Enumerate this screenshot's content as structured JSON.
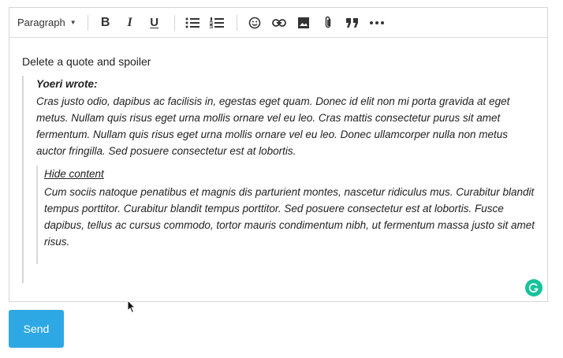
{
  "toolbar": {
    "format_label": "Paragraph",
    "buttons": [
      {
        "name": "bold-button",
        "glyph": "B"
      },
      {
        "name": "italic-button",
        "glyph": "I"
      },
      {
        "name": "underline-button",
        "glyph": "U"
      }
    ]
  },
  "editor": {
    "intro": "Delete a quote and spoiler",
    "quote": {
      "author": "Yoeri wrote:",
      "text": "Cras justo odio, dapibus ac facilisis in, egestas eget quam. Donec id elit non mi porta gravida at eget metus. Nullam quis risus eget urna mollis ornare vel eu leo. Cras mattis consectetur purus sit amet fermentum. Nullam quis risus eget urna mollis ornare vel eu leo. Donec ullamcorper nulla non metus auctor fringilla. Sed posuere consectetur est at lobortis."
    },
    "spoiler": {
      "title": "Hide content",
      "text": "Cum sociis natoque penatibus et magnis dis parturient montes, nascetur ridiculus mus. Curabitur blandit tempus porttitor. Curabitur blandit tempus porttitor. Sed posuere consectetur est at lobortis. Fusce dapibus, tellus ac cursus commodo, tortor mauris condimentum nibh, ut fermentum massa justo sit amet risus."
    }
  },
  "send_label": "Send",
  "colors": {
    "send_button": "#2ea8e5",
    "grammarly": "#15c39a",
    "quote_border": "#d8d8d8"
  }
}
